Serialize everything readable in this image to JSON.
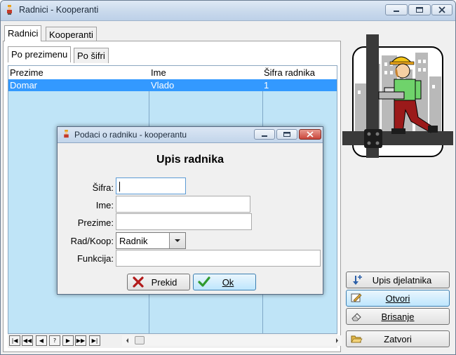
{
  "window": {
    "title": "Radnici - Kooperanti"
  },
  "outer_tabs": [
    {
      "label": "Radnici"
    },
    {
      "label": "Kooperanti"
    }
  ],
  "inner_tabs": [
    {
      "label": "Po prezimenu"
    },
    {
      "label": "Po šifri"
    }
  ],
  "grid": {
    "columns": [
      "Prezime",
      "Ime",
      "Šifra radnika"
    ],
    "rows": [
      {
        "prezime": "Domar",
        "ime": "Vlado",
        "sifra": "1"
      }
    ]
  },
  "navigator": {
    "buttons": [
      {
        "name": "first",
        "glyph": "|◀"
      },
      {
        "name": "prev-page",
        "glyph": "◀◀"
      },
      {
        "name": "prev",
        "glyph": "◀"
      },
      {
        "name": "help",
        "glyph": "?"
      },
      {
        "name": "next",
        "glyph": "▶"
      },
      {
        "name": "next-page",
        "glyph": "▶▶"
      },
      {
        "name": "last",
        "glyph": "▶|"
      }
    ]
  },
  "side_buttons": {
    "upis": "Upis djelatnika",
    "otvori": "Otvori",
    "brisanje": "Brisanje",
    "zatvori": "Zatvori"
  },
  "dialog": {
    "title": "Podaci o radniku - kooperantu",
    "heading": "Upis radnika",
    "fields": {
      "sifra": {
        "label": "Šifra:",
        "value": ""
      },
      "ime": {
        "label": "Ime:",
        "value": ""
      },
      "prezime": {
        "label": "Prezime:",
        "value": ""
      },
      "radkoop": {
        "label": "Rad/Koop:",
        "value": "Radnik"
      },
      "funkcija": {
        "label": "Funkcija:",
        "value": ""
      }
    },
    "buttons": {
      "prekid": "Prekid",
      "ok": "Ok"
    }
  },
  "colors": {
    "grid_background": "#bfe4f7",
    "selected_row": "#3399ff",
    "close_button": "#c9453a"
  }
}
